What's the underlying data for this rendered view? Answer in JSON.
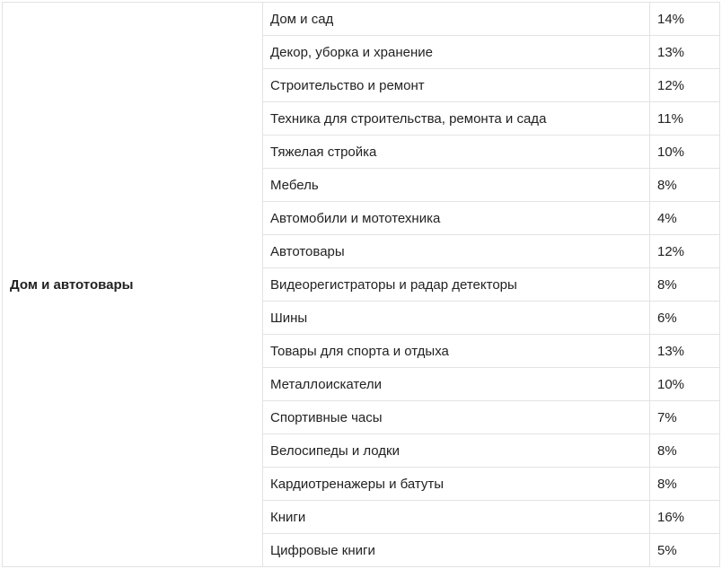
{
  "table": {
    "group_label": "Дом и автотовары",
    "rows": [
      {
        "category": "Дом и сад",
        "rate": "14%"
      },
      {
        "category": "Декор, уборка и хранение",
        "rate": "13%"
      },
      {
        "category": "Строительство и ремонт",
        "rate": "12%"
      },
      {
        "category": "Техника для строительства, ремонта и сада",
        "rate": "11%"
      },
      {
        "category": "Тяжелая стройка",
        "rate": "10%"
      },
      {
        "category": "Мебель",
        "rate": "8%"
      },
      {
        "category": "Автомобили и мототехника",
        "rate": "4%"
      },
      {
        "category": "Автотовары",
        "rate": "12%"
      },
      {
        "category": "Видеорегистраторы и радар детекторы",
        "rate": "8%"
      },
      {
        "category": "Шины",
        "rate": "6%"
      },
      {
        "category": "Товары для спорта и отдыха",
        "rate": "13%"
      },
      {
        "category": "Металлоискатели",
        "rate": "10%"
      },
      {
        "category": "Спортивные часы",
        "rate": "7%"
      },
      {
        "category": "Велосипеды и лодки",
        "rate": "8%"
      },
      {
        "category": "Кардиотренажеры и батуты",
        "rate": "8%"
      },
      {
        "category": "Книги",
        "rate": "16%"
      },
      {
        "category": "Цифровые книги",
        "rate": "5%"
      }
    ]
  }
}
